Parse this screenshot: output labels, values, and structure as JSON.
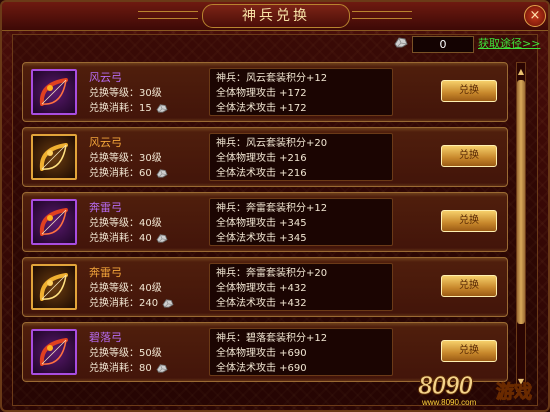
{
  "window": {
    "title": "神兵兑换",
    "close_label": "×"
  },
  "header": {
    "currency_value": "0",
    "get_link": "获取途径>>"
  },
  "items": [
    {
      "name": "风云弓",
      "tier": "purple",
      "level_label": "兑换等级：",
      "level": "30级",
      "cost_label": "兑换消耗：",
      "cost": "15",
      "attrs": [
        "神兵：风云套装积分+12",
        "全体物理攻击 +172",
        "全体法术攻击 +172"
      ],
      "button": "兑换"
    },
    {
      "name": "风云弓",
      "tier": "gold",
      "level_label": "兑换等级：",
      "level": "30级",
      "cost_label": "兑换消耗：",
      "cost": "60",
      "attrs": [
        "神兵：风云套装积分+20",
        "全体物理攻击 +216",
        "全体法术攻击 +216"
      ],
      "button": "兑换"
    },
    {
      "name": "奔雷弓",
      "tier": "purple",
      "level_label": "兑换等级：",
      "level": "40级",
      "cost_label": "兑换消耗：",
      "cost": "40",
      "attrs": [
        "神兵：奔雷套装积分+12",
        "全体物理攻击 +345",
        "全体法术攻击 +345"
      ],
      "button": "兑换"
    },
    {
      "name": "奔雷弓",
      "tier": "gold",
      "level_label": "兑换等级：",
      "level": "40级",
      "cost_label": "兑换消耗：",
      "cost": "240",
      "attrs": [
        "神兵：奔雷套装积分+20",
        "全体物理攻击 +432",
        "全体法术攻击 +432"
      ],
      "button": "兑换"
    },
    {
      "name": "碧落弓",
      "tier": "purple",
      "level_label": "兑换等级：",
      "level": "50级",
      "cost_label": "兑换消耗：",
      "cost": "80",
      "attrs": [
        "神兵：碧落套装积分+12",
        "全体物理攻击 +690",
        "全体法术攻击 +690"
      ],
      "button": "兑换"
    }
  ],
  "watermark": {
    "number": "8090",
    "text": "游戏",
    "url": "www.8090.com"
  },
  "colors": {
    "purple_name": "#b66cf2",
    "gold_name": "#f2a43a",
    "link": "#3fe23a",
    "panel_bg": "#3a0906"
  },
  "icons": {
    "close": "close-icon",
    "currency": "stone-icon",
    "item": "bow-icon"
  }
}
